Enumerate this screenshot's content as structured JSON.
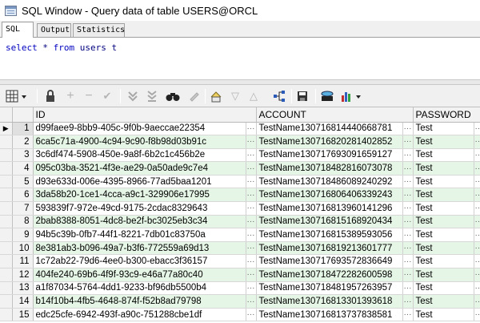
{
  "window": {
    "title": "SQL Window - Query data of table USERS@ORCL"
  },
  "tabs": [
    {
      "label": "SQL",
      "active": true
    },
    {
      "label": "Output",
      "active": false
    },
    {
      "label": "Statistics",
      "active": false
    }
  ],
  "editor": {
    "sql": [
      "select",
      " * ",
      "from",
      " users t"
    ]
  },
  "toolbar": {
    "icons": [
      "grid-menu-icon",
      "lock-icon",
      "insert-record-icon",
      "delete-record-icon",
      "post-changes-icon",
      "fetch-next-icon",
      "fetch-last-icon",
      "query-by-example-icon",
      "clear-record-icon",
      "single-record-view-icon",
      "previous-record-icon",
      "next-record-icon",
      "link-icon",
      "save-icon",
      "print-icon",
      "export-icon"
    ]
  },
  "grid": {
    "columns": [
      "ID",
      "ACCOUNT",
      "PASSWORD"
    ],
    "rows": [
      {
        "n": "1",
        "id": "d99faee9-8bb9-405c-9f0b-9aeccae22354",
        "account": "TestName130716814440668781",
        "password": "Test"
      },
      {
        "n": "2",
        "id": "6ca5c71a-4900-4c94-9c90-f8b98d03b91c",
        "account": "TestName130716820281402852",
        "password": "Test"
      },
      {
        "n": "3",
        "id": "3c6df474-5908-450e-9a8f-6b2c1c456b2e",
        "account": "TestName130717693091659127",
        "password": "Test"
      },
      {
        "n": "4",
        "id": "095c03ba-3521-4f3e-ae29-0a50ade9c7e4",
        "account": "TestName130718482816073078",
        "password": "Test"
      },
      {
        "n": "5",
        "id": "d93e633d-006e-4395-8966-77ad5baa1201",
        "account": "TestName130718486089240292",
        "password": "Test"
      },
      {
        "n": "6",
        "id": "3da58b20-1ce1-4cca-a9c1-329906e17995",
        "account": "TestName130716806406339243",
        "password": "Test"
      },
      {
        "n": "7",
        "id": "593839f7-972e-49cd-9175-2cdac8329643",
        "account": "TestName130716813960141296",
        "password": "Test"
      },
      {
        "n": "8",
        "id": "2bab8388-8051-4dc8-be2f-bc3025eb3c34",
        "account": "TestName130716815168920434",
        "password": "Test"
      },
      {
        "n": "9",
        "id": "94b5c39b-0fb7-44f1-8221-7db01c83750a",
        "account": "TestName130716815389593056",
        "password": "Test"
      },
      {
        "n": "10",
        "id": "8e381ab3-b096-49a7-b3f6-772559a69d13",
        "account": "TestName130716819213601777",
        "password": "Test"
      },
      {
        "n": "11",
        "id": "1c72ab22-79d6-4ee0-b300-ebacc3f36157",
        "account": "TestName130717693572836649",
        "password": "Test"
      },
      {
        "n": "12",
        "id": "404fe240-69b6-4f9f-93c9-e46a77a80c40",
        "account": "TestName130718472282600598",
        "password": "Test"
      },
      {
        "n": "13",
        "id": "a1f87034-5764-4dd1-9233-bf96db5500b4",
        "account": "TestName130718481957263957",
        "password": "Test"
      },
      {
        "n": "14",
        "id": "b14f10b4-4fb5-4648-874f-f52b8ad79798",
        "account": "TestName130716813301393618",
        "password": "Test"
      },
      {
        "n": "15",
        "id": "edc25cfe-6942-493f-a90c-751288cbe1df",
        "account": "TestName130716813737838581",
        "password": "Test"
      }
    ],
    "cell_button": "···",
    "current_row_marker": "▶"
  }
}
